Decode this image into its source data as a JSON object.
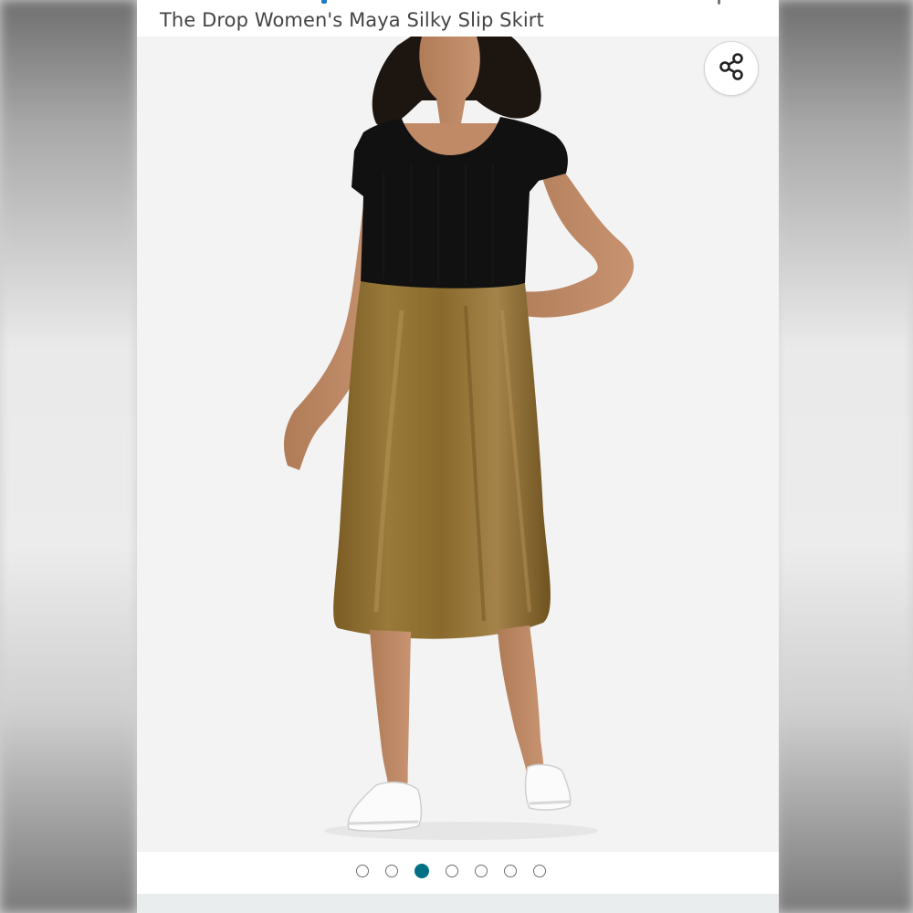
{
  "product": {
    "title": "The Drop Women's Maya Silky Slip Skirt"
  },
  "gallery": {
    "image_alt": "Model wearing an olive satin midi slip skirt with a black square-neck top and white sneakers",
    "share_icon": "share-icon",
    "total_images": 7,
    "active_index": 2
  },
  "colors": {
    "accent_dot": "#007185",
    "skirt": "#8a6a2c",
    "top": "#111111"
  }
}
